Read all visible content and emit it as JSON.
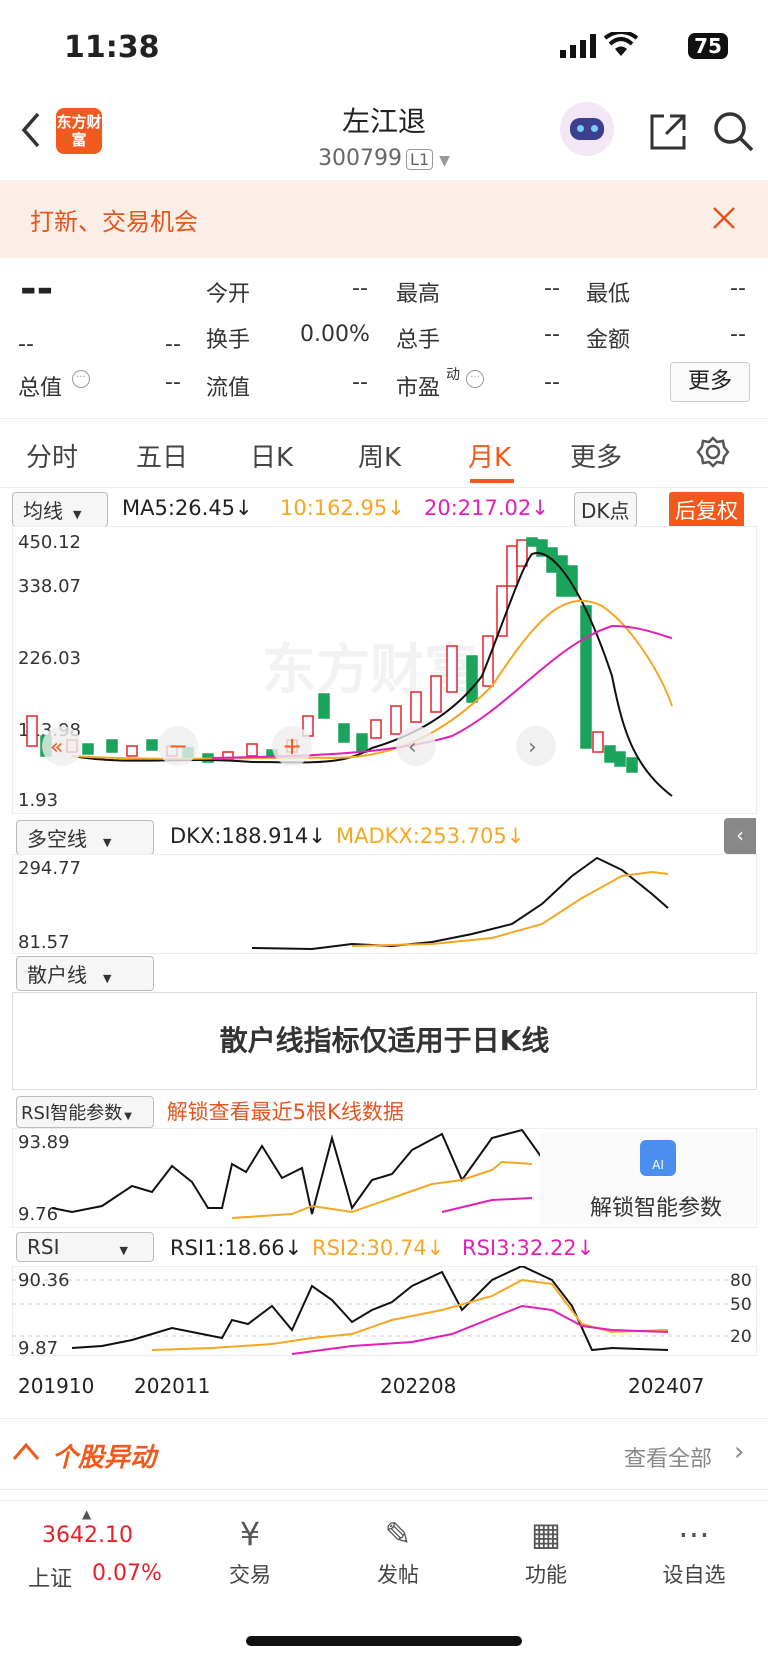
{
  "status": {
    "time": "11:38",
    "battery": "75"
  },
  "header": {
    "logo": "东方财富",
    "title": "左江退",
    "code": "300799",
    "level": "L1"
  },
  "banner": {
    "text": "打新、交易机会"
  },
  "quote": {
    "price": "--",
    "change": "--",
    "change_pct": "--",
    "fields": [
      {
        "label": "今开",
        "value": "--"
      },
      {
        "label": "最高",
        "value": "--"
      },
      {
        "label": "最低",
        "value": "--"
      },
      {
        "label": "换手",
        "value": "0.00%"
      },
      {
        "label": "总手",
        "value": "--"
      },
      {
        "label": "金额",
        "value": "--"
      },
      {
        "label": "总值",
        "value": "--"
      },
      {
        "label": "流值",
        "value": "--"
      },
      {
        "label": "市盈",
        "value": "--"
      }
    ],
    "pe_sup": "动",
    "more": "更多"
  },
  "tabs": [
    "分时",
    "五日",
    "日K",
    "周K",
    "月K",
    "更多"
  ],
  "ma": {
    "select": "均线",
    "ma5": "MA5:26.45↓",
    "ma10": "10:162.95↓",
    "ma20": "20:217.02↓",
    "dk": "DK点",
    "fq": "后复权",
    "y_ticks": [
      "450.12",
      "338.07",
      "226.03",
      "113.98",
      "1.93"
    ]
  },
  "dkx": {
    "select": "多空线",
    "dkx": "DKX:188.914↓",
    "madkx": "MADKX:253.705↓",
    "y_ticks": [
      "294.77",
      "81.57"
    ]
  },
  "sanhu": {
    "select": "散户线",
    "msg": "散户线指标仅适用于日K线"
  },
  "rsi_smart": {
    "select": "RSI智能参数",
    "unlock": "解锁查看最近5根K线数据",
    "y_ticks": [
      "93.89",
      "9.76"
    ],
    "ai": "解锁智能参数",
    "ai_badge": "AI"
  },
  "rsi": {
    "select": "RSI",
    "rsi1": "RSI1:18.66↓",
    "rsi2": "RSI2:30.74↓",
    "rsi3": "RSI3:32.22↓",
    "y_ticks": [
      "90.36",
      "9.87"
    ],
    "right_ticks": [
      "80",
      "50",
      "20"
    ]
  },
  "x_dates": [
    "201910",
    "202011",
    "202208",
    "202407"
  ],
  "movers": {
    "title": "个股异动",
    "link": "查看全部"
  },
  "nav": {
    "index_value": "3642.10",
    "index_name": "上证",
    "index_pct": "0.07%",
    "items": [
      "交易",
      "发帖",
      "功能",
      "设自选"
    ]
  },
  "colors": {
    "accent": "#f2591c",
    "up": "#e8202a",
    "down": "#1aa35a",
    "ma10": "#f5a623",
    "ma20": "#e21fb6"
  },
  "chart_data": {
    "type": "candlestick",
    "title": "",
    "xlabel": "",
    "ylabel": "",
    "ylim": [
      1.93,
      450.12
    ],
    "x": [
      "201910",
      "202011",
      "202208",
      "202407"
    ],
    "series": [
      {
        "name": "MA5",
        "last": 26.45
      },
      {
        "name": "MA10",
        "last": 162.95
      },
      {
        "name": "MA20",
        "last": 217.02
      }
    ]
  }
}
